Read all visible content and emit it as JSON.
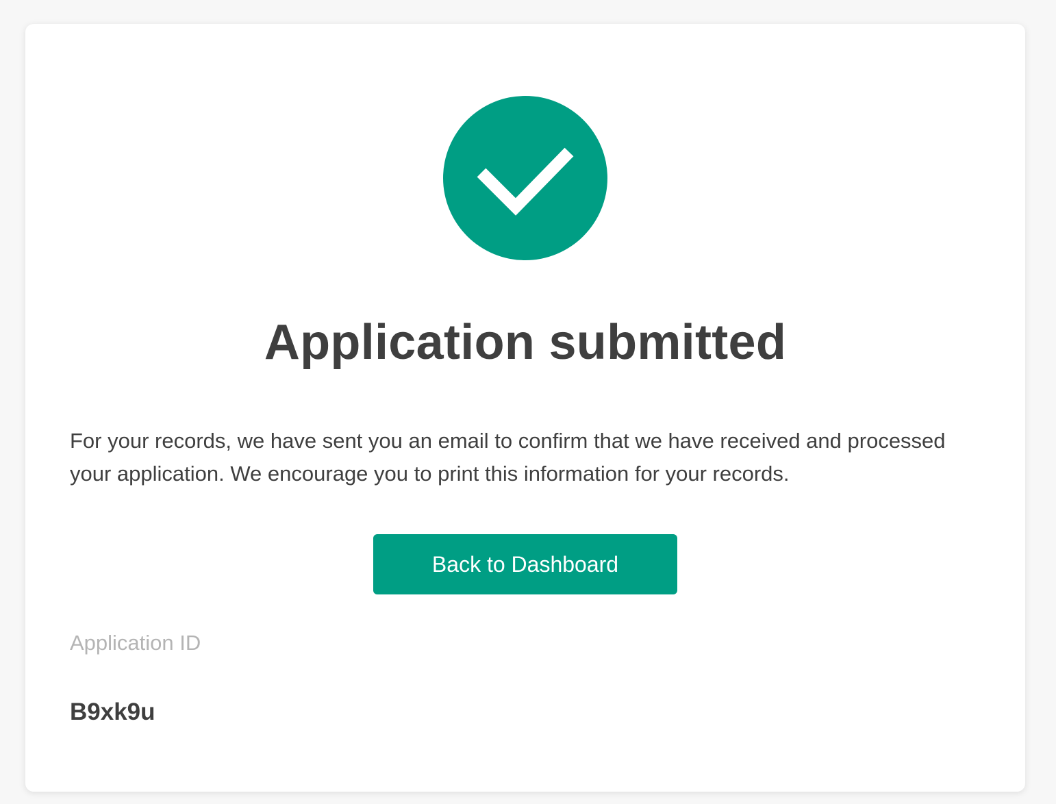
{
  "confirmation": {
    "icon": "checkmark-circle-icon",
    "accent_color": "#009e84",
    "title": "Application submitted",
    "message": "For your records, we have sent you an email to confirm that we have received and processed your application. We encourage you to print this information for your records.",
    "button_label": "Back to Dashboard",
    "application_id_label": "Application ID",
    "application_id_value": "B9xk9u"
  }
}
